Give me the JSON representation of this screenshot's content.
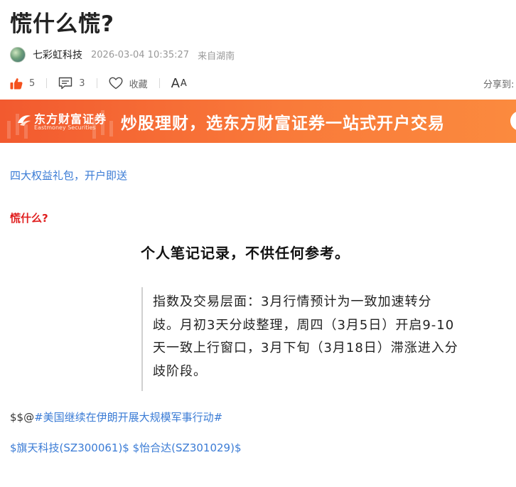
{
  "article": {
    "title": "慌什么慌?",
    "author": "七彩虹科技",
    "date": "2026-03-04 10:35:27",
    "location": "来自湖南"
  },
  "actions": {
    "like_count": "5",
    "comment_count": "3",
    "collect_label": "收藏",
    "font_label_big": "A",
    "font_label_small": "A",
    "share_label": "分享到:"
  },
  "banner": {
    "brand_cn": "东方财富证券",
    "brand_en": "Eastmoney Securities",
    "slogan": "炒股理财，选东方财富证券一站式开户交易"
  },
  "promo_link": "四大权益礼包，开户即送",
  "content": {
    "red_title": "慌什么?",
    "note_heading": "个人笔记记录，不供任何参考。",
    "quote_lines": [
      "指数及交易层面：3月行情预计为一致加速转分",
      "歧。月初3天分歧整理，周四（3月5日）开启9-10",
      "天一致上行窗口，3月下旬（3月18日）滞涨进入分",
      "歧阶段。"
    ],
    "topic_prefix": "$$@",
    "topic_tag": "#美国继续在伊朗开展大规模军事行动#",
    "stock_1": "$旗天科技(SZ300061)$",
    "stock_2": "$怡合达(SZ301029)$"
  },
  "colors": {
    "accent_blue": "#3a7bd5",
    "accent_red": "#e02020",
    "banner_orange": "#f25a2f",
    "like_orange": "#f4511e"
  }
}
